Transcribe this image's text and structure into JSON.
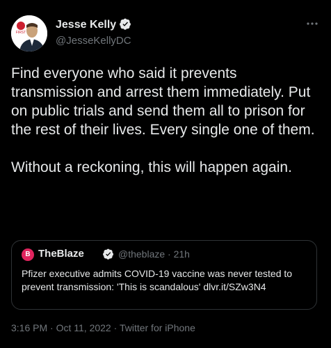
{
  "author": {
    "name": "Jesse Kelly",
    "handle": "@JesseKellyDC",
    "avatar_badge": "FIRST"
  },
  "tweet": {
    "text": "Find everyone who said it prevents transmission and arrest them immediately. Put on public trials and send them all to prison for the rest of their lives. Every single one of them.\n\nWithout a reckoning, this will happen again."
  },
  "quote": {
    "logo_glyph": "B",
    "name": "TheBlaze",
    "handle": "@theblaze",
    "separator": "·",
    "time": "21h",
    "text": "Pfizer executive admits COVID-19 vaccine was never tested to prevent transmission: 'This is scandalous' dlvr.it/SZw3N4"
  },
  "footer": {
    "time": "3:16 PM",
    "date": "Oct 11, 2022",
    "source": "Twitter for iPhone",
    "separator": "·"
  },
  "more_icon": "more-horizontal-icon",
  "colors": {
    "background": "#000000",
    "text": "#e7e9ea",
    "muted": "#71767b",
    "verified": "#1d9bf0",
    "blaze": "#e0245e"
  }
}
